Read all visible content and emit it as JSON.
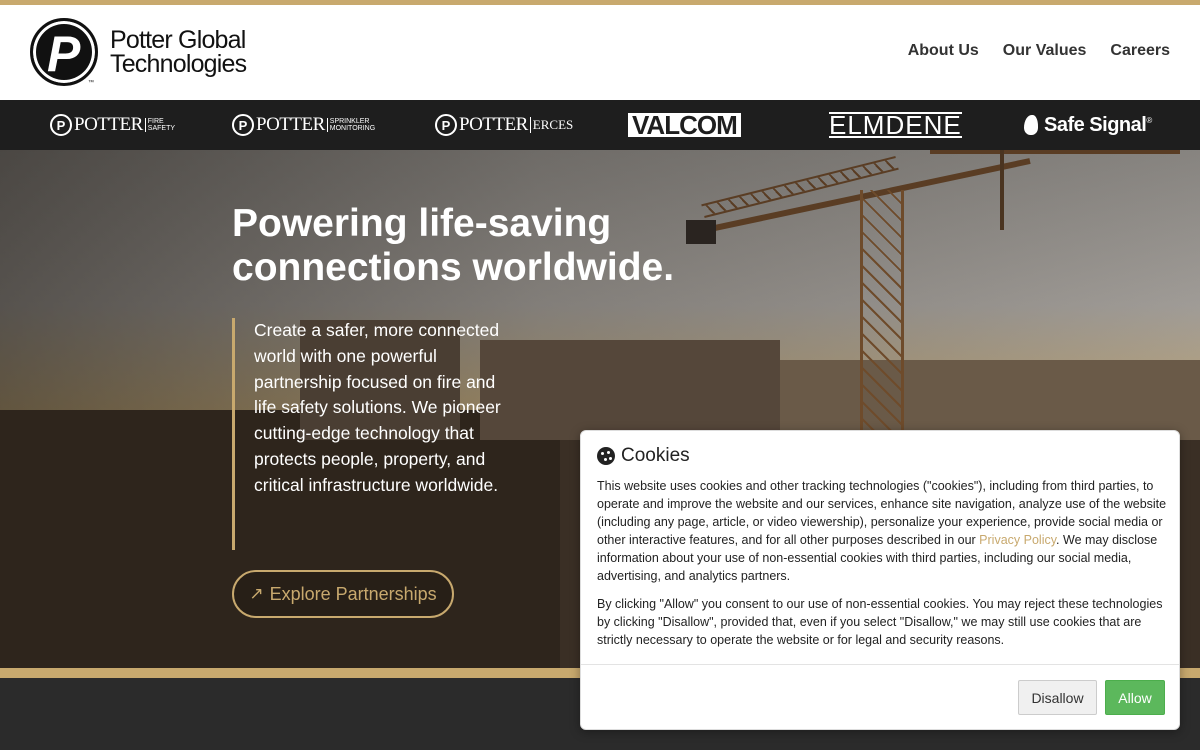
{
  "header": {
    "logo_line1": "Potter Global",
    "logo_line2": "Technologies",
    "logo_letter": "P",
    "logo_tm": "™",
    "nav": [
      "About Us",
      "Our Values",
      "Careers"
    ]
  },
  "brands": {
    "potter_fire": {
      "name": "POTTER",
      "sub": "FIRE SAFETY"
    },
    "potter_sprinkler": {
      "name": "POTTER",
      "sub": "SPRINKLER MONITORING"
    },
    "potter_erces": {
      "name": "POTTER",
      "sub": "ERCES"
    },
    "valcom": "VALCOM",
    "elmdene": "ELMDENE",
    "safesignal": "Safe Signal",
    "safesignal_mark": "®"
  },
  "hero": {
    "title": "Powering life-saving connections worldwide.",
    "description": "Create a safer, more connected world with one powerful partnership focused on fire and life safety solutions. We pioneer cutting-edge technology that protects people, property, and critical infrastructure worldwide.",
    "cta_label": "Explore Partnerships",
    "cta_icon": "arrow-up-right-icon"
  },
  "cookie": {
    "title": "Cookies",
    "p1_before": "This website uses cookies and other tracking technologies (\"cookies\"), including from third parties, to operate and improve the website and our services, enhance site navigation, analyze use of the website (including any page, article, or video viewership), personalize your experience, provide social media or other interactive features, and for all other purposes described in our ",
    "p1_link": "Privacy Policy",
    "p1_after": ". We may disclose information about your use of non-essential cookies with third parties, including our social media, advertising, and analytics partners.",
    "p2": "By clicking \"Allow\" you consent to our use of non-essential cookies. You may reject these technologies by clicking \"Disallow\", provided that, even if you select \"Disallow,\" we may still use cookies that are strictly necessary to operate the website or for legal and security reasons.",
    "disallow_label": "Disallow",
    "allow_label": "Allow"
  },
  "colors": {
    "accent": "#c8a96e",
    "dark": "#1e1e1e",
    "allow_green": "#5cb85c"
  }
}
